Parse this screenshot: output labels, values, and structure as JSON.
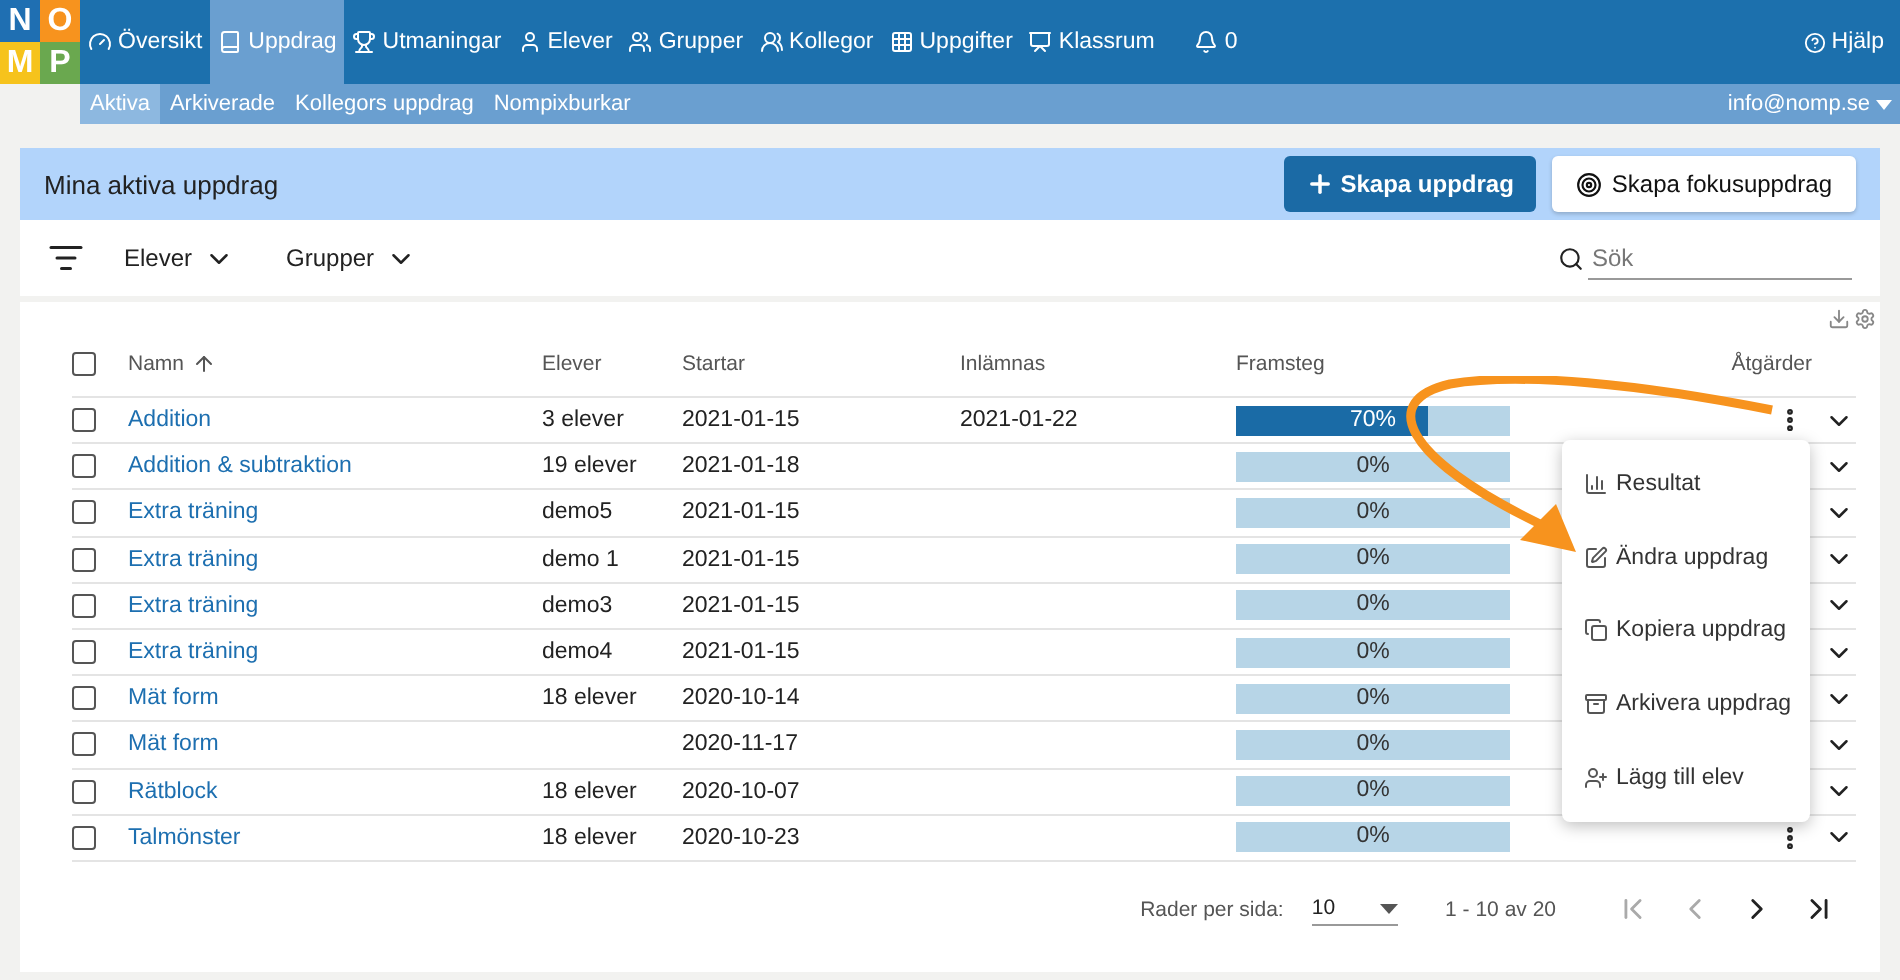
{
  "logo": {
    "letters": [
      {
        "char": "N",
        "color": "#1f6fb2"
      },
      {
        "char": "O",
        "color": "#f7931e"
      },
      {
        "char": "M",
        "color": "#f6c31c"
      },
      {
        "char": "P",
        "color": "#6aa84f"
      }
    ]
  },
  "nav": {
    "items": [
      {
        "label": "Översikt",
        "selected": false
      },
      {
        "label": "Uppdrag",
        "selected": true
      },
      {
        "label": "Utmaningar",
        "selected": false
      },
      {
        "label": "Elever",
        "selected": false
      },
      {
        "label": "Grupper",
        "selected": false
      },
      {
        "label": "Kollegor",
        "selected": false
      },
      {
        "label": "Uppgifter",
        "selected": false
      },
      {
        "label": "Klassrum",
        "selected": false
      }
    ],
    "notifications": "0",
    "help": "Hjälp"
  },
  "subnav": {
    "items": [
      {
        "label": "Aktiva",
        "selected": true
      },
      {
        "label": "Arkiverade",
        "selected": false
      },
      {
        "label": "Kollegors uppdrag",
        "selected": false
      },
      {
        "label": "Nompixburkar",
        "selected": false
      }
    ],
    "account": "info@nomp.se"
  },
  "header": {
    "title": "Mina aktiva uppdrag",
    "create_button": "Skapa uppdrag",
    "focus_button": "Skapa fokusuppdrag"
  },
  "filters": {
    "dropdowns": [
      "Elever",
      "Grupper"
    ],
    "search_placeholder": "Sök"
  },
  "table": {
    "all_checked": false,
    "columns": [
      "Namn",
      "Elever",
      "Startar",
      "Inlämnas",
      "Framsteg",
      "Åtgärder"
    ],
    "rows": [
      {
        "name": "Addition",
        "students": "3 elever",
        "start": "2021-01-15",
        "due": "2021-01-22",
        "level": 0.7,
        "progress": "70%",
        "checked": false,
        "menu_open": true
      },
      {
        "name": "Addition & subtraktion",
        "students": "19 elever",
        "start": "2021-01-18",
        "level": 0,
        "progress": "0%",
        "checked": false,
        "menu_open": false
      },
      {
        "name": "Extra träning",
        "students": "demo5",
        "start": "2021-01-15",
        "level": 0,
        "progress": "0%",
        "checked": false,
        "menu_open": false
      },
      {
        "name": "Extra träning",
        "students": "demo 1",
        "start": "2021-01-15",
        "level": 0,
        "progress": "0%",
        "checked": false,
        "menu_open": false
      },
      {
        "name": "Extra träning",
        "students": "demo3",
        "start": "2021-01-15",
        "level": 0,
        "progress": "0%",
        "checked": false,
        "menu_open": false
      },
      {
        "name": "Extra träning",
        "students": "demo4",
        "start": "2021-01-15",
        "level": 0,
        "progress": "0%",
        "checked": false,
        "menu_open": false
      },
      {
        "name": "Mät form",
        "students": "18 elever",
        "start": "2020-10-14",
        "level": 0,
        "progress": "0%",
        "checked": false,
        "menu_open": false
      },
      {
        "name": "Mät form",
        "start": "2020-11-17",
        "level": 0,
        "progress": "0%",
        "checked": false,
        "menu_open": false
      },
      {
        "name": "Rätblock",
        "students": "18 elever",
        "start": "2020-10-07",
        "level": 0,
        "progress": "0%",
        "checked": false,
        "menu_open": false
      },
      {
        "name": "Talmönster",
        "students": "18 elever",
        "start": "2020-10-23",
        "level": 0,
        "progress": "0%",
        "checked": false,
        "menu_open": false
      }
    ]
  },
  "actions_menu": [
    "Resultat",
    "Ändra uppdrag",
    "Kopiera uppdrag",
    "Arkivera uppdrag",
    "Lägg till elev"
  ],
  "pagination": {
    "rows_label": "Rader per sida:",
    "rows_value": "10",
    "range": "1 - 10 av 20"
  }
}
